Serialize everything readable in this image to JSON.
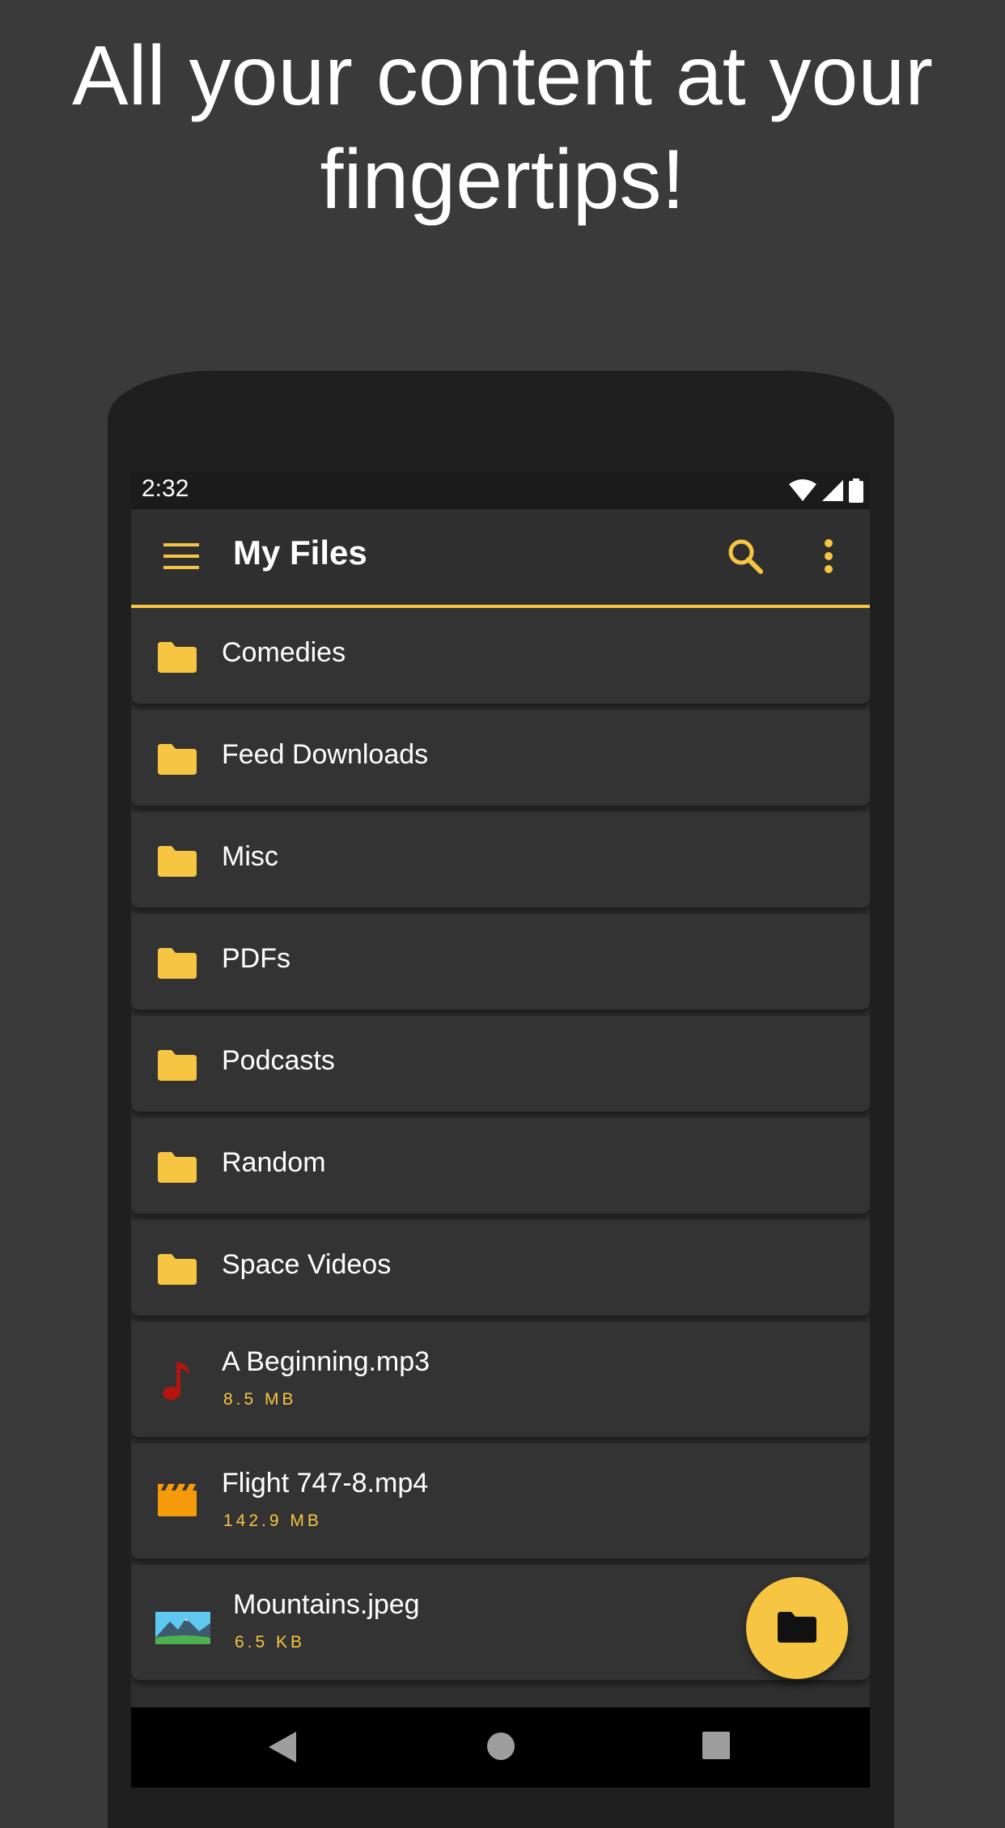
{
  "headline": {
    "line1": "All your content at your",
    "line2": "fingertips!"
  },
  "status": {
    "time": "2:32",
    "icons": [
      "wifi-icon",
      "signal-icon",
      "battery-icon"
    ]
  },
  "appbar": {
    "title": "My Files",
    "icons": [
      "menu-icon",
      "search-icon",
      "more-vert-icon"
    ]
  },
  "folders": [
    {
      "name": "Comedies"
    },
    {
      "name": "Feed Downloads"
    },
    {
      "name": "Misc"
    },
    {
      "name": "PDFs"
    },
    {
      "name": "Podcasts"
    },
    {
      "name": "Random"
    },
    {
      "name": "Space Videos"
    }
  ],
  "files": [
    {
      "name": "A Beginning.mp3",
      "size": "8.5 MB",
      "icon": "music-note-icon"
    },
    {
      "name": "Flight 747-8.mp4",
      "size": "142.9 MB",
      "icon": "movie-clapper-icon"
    },
    {
      "name": "Mountains.jpeg",
      "size": "6.5 KB",
      "icon": "image-thumbnail-icon"
    }
  ],
  "fab": {
    "icon": "folder-icon"
  },
  "navbar": {
    "icons": [
      "back-icon",
      "home-icon",
      "recents-icon"
    ]
  },
  "colors": {
    "accent": "#f6c542",
    "background": "#3a3a3a",
    "row": "#333333"
  }
}
